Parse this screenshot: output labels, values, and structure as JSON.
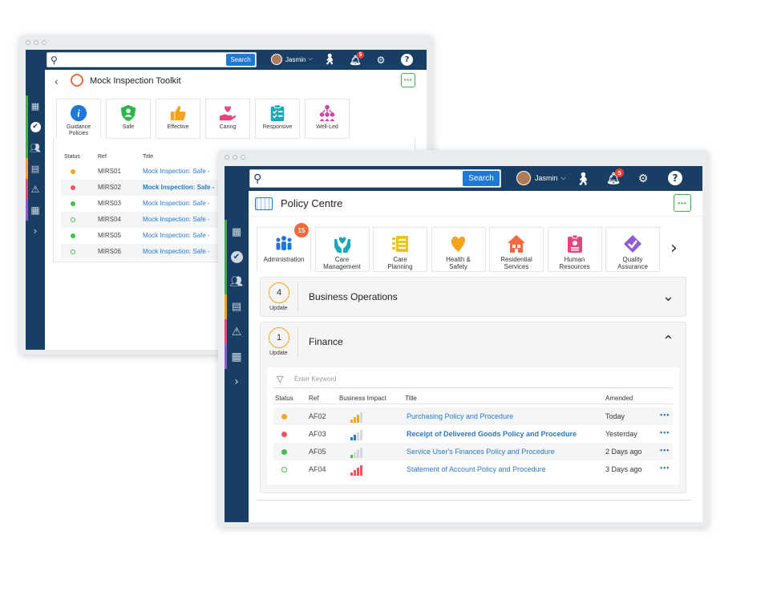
{
  "back_window": {
    "search_button": "Search",
    "user_name": "Jasmin",
    "notification_count": "5",
    "title": "Mock Inspection Toolkit",
    "more_label": "•••",
    "categories": [
      {
        "label": "Guidance\nPolicies",
        "icon": "info-icon",
        "color": "#1e78d6"
      },
      {
        "label": "Safe",
        "icon": "shield-person-icon",
        "color": "#2fb54a"
      },
      {
        "label": "Effective",
        "icon": "thumbs-up-icon",
        "color": "#f6a21c"
      },
      {
        "label": "Caring",
        "icon": "caring-hand-heart-icon",
        "color": "#e8457a"
      },
      {
        "label": "Responsive",
        "icon": "clipboard-icon",
        "color": "#1aa7b8"
      },
      {
        "label": "Well-Led",
        "icon": "people-network-icon",
        "color": "#d43fa6"
      }
    ],
    "table": {
      "headers": {
        "status": "Status",
        "ref": "Ref",
        "title": "Title"
      },
      "rows": [
        {
          "status": "#f5a623",
          "hollow": false,
          "ref": "MIRS01",
          "title": "Mock Inspection: Safe -",
          "bold": false
        },
        {
          "status": "#f2545b",
          "hollow": false,
          "ref": "MIRS02",
          "title": "Mock Inspection: Safe -",
          "bold": true
        },
        {
          "status": "#3fbf4a",
          "hollow": false,
          "ref": "MIRS03",
          "title": "Mock Inspection: Safe -",
          "bold": false
        },
        {
          "status": "#3fbf4a",
          "hollow": true,
          "ref": "MIRS04",
          "title": "Mock Inspection: Safe -",
          "bold": false
        },
        {
          "status": "#3fbf4a",
          "hollow": false,
          "ref": "MIRS05",
          "title": "Mock Inspection: Safe -",
          "bold": false
        },
        {
          "status": "#3fbf4a",
          "hollow": true,
          "ref": "MIRS06",
          "title": "Mock Inspection: Safe -",
          "bold": false
        }
      ]
    }
  },
  "front_window": {
    "search_button": "Search",
    "user_name": "Jasmin",
    "notification_count": "5",
    "title": "Policy Centre",
    "more_label": "•••",
    "admin_badge": "15",
    "categories": [
      {
        "label": "Administration",
        "icon": "people-group-icon",
        "color": "#1e78d6"
      },
      {
        "label": "Care\nManagement",
        "icon": "care-hands-heart-icon",
        "color": "#1aa7b8"
      },
      {
        "label": "Care\nPlanning",
        "icon": "planning-list-icon",
        "color": "#f2c418"
      },
      {
        "label": "Health &\nSafety",
        "icon": "heart-icon",
        "color": "#f6a21c"
      },
      {
        "label": "Residential\nServices",
        "icon": "house-icon",
        "color": "#f26a3d"
      },
      {
        "label": "Human\nResources",
        "icon": "id-badge-icon",
        "color": "#e8457a"
      },
      {
        "label": "Quality\nAssurance",
        "icon": "quality-check-icon",
        "color": "#8e5bd8"
      }
    ],
    "sections": [
      {
        "count": "4",
        "count_label": "Update",
        "title": "Business Operations"
      },
      {
        "count": "1",
        "count_label": "Update",
        "title": "Finance"
      }
    ],
    "filter_placeholder": "Enter Keyword",
    "table": {
      "headers": {
        "status": "Status",
        "ref": "Ref",
        "impact": "Business Impact",
        "title": "Title",
        "amended": "Amended"
      },
      "rows": [
        {
          "status": "#f5a623",
          "hollow": false,
          "ref": "AF02",
          "impact_level": 3,
          "impact_color": "#f5a623",
          "title": "Purchasing Policy and Procedure",
          "bold": false,
          "amended": "Today"
        },
        {
          "status": "#f2545b",
          "hollow": false,
          "ref": "AF03",
          "impact_level": 2,
          "impact_color": "#2b78c5",
          "title": "Receipt of Delivered Goods Policy and Procedure",
          "bold": true,
          "amended": "Yesterday"
        },
        {
          "status": "#3fbf4a",
          "hollow": false,
          "ref": "AF05",
          "impact_level": 1,
          "impact_color": "#3fbf4a",
          "title": "Service User's Finances Policy and Procedure",
          "bold": false,
          "amended": "2 Days ago"
        },
        {
          "status": "#3fbf4a",
          "hollow": true,
          "ref": "AF04",
          "impact_level": 4,
          "impact_color": "#f2545b",
          "title": "Statement of Account Policy and Procedure",
          "bold": false,
          "amended": "3 Days ago"
        }
      ]
    }
  }
}
